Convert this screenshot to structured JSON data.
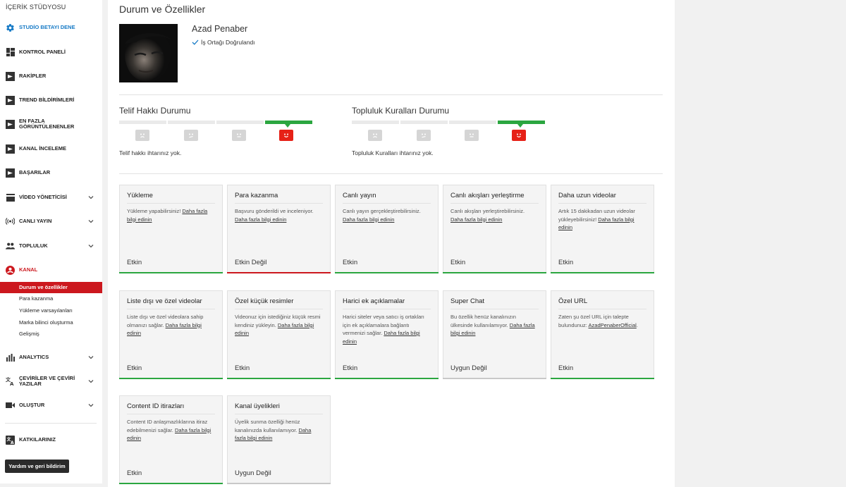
{
  "sidebar": {
    "header": "İÇERİK STÜDYOSU",
    "items": [
      {
        "label": "STUDİO BETAYI DENE",
        "icon": "gear-icon"
      },
      {
        "label": "KONTROL PANELİ",
        "icon": "dashboard-icon"
      },
      {
        "label": "RAKİPLER",
        "icon": "vidiq-icon"
      },
      {
        "label": "TREND BİLDİRİMLERİ",
        "icon": "vidiq-icon"
      },
      {
        "label_line1": "EN FAZLA",
        "label_line2": "GÖRÜNTÜLENENLER",
        "icon": "vidiq-icon"
      },
      {
        "label": "KANAL İNCELEME",
        "icon": "vidiq-icon"
      },
      {
        "label": "BAŞARILAR",
        "icon": "vidiq-icon"
      },
      {
        "label": "VİDEO YÖNETİCİSİ",
        "icon": "video-manager-icon"
      },
      {
        "label": "CANLI YAYIN",
        "icon": "live-icon"
      },
      {
        "label": "TOPLULUK",
        "icon": "community-icon"
      },
      {
        "label": "KANAL",
        "icon": "channel-icon"
      },
      {
        "label": "ANALYTICS",
        "icon": "analytics-icon"
      },
      {
        "label_line1": "ÇEVİRİLER VE ÇEVİRİ",
        "label_line2": "YAZILAR",
        "icon": "translate-icon"
      },
      {
        "label": "OLUŞTUR",
        "icon": "create-icon"
      },
      {
        "label": "KATKILARINIZ",
        "icon": "contributions-icon"
      }
    ],
    "sub_items": [
      "Durum ve özellikler",
      "Para kazanma",
      "Yükleme varsayılanları",
      "Marka bilinci oluşturma",
      "Gelişmiş"
    ],
    "feedback_button": "Yardım ve geri bildirim"
  },
  "main": {
    "title": "Durum ve Özellikler",
    "channel_name": "Azad Penaber",
    "verified_text": "İş Ortağı Doğrulandı",
    "copyright": {
      "title": "Telif Hakkı Durumu",
      "note": "Telif hakkı ihtarınız yok.",
      "level": 4,
      "levels": 4
    },
    "community": {
      "title": "Topluluk Kuralları Durumu",
      "note": "Topluluk Kuralları ihtarınız yok.",
      "level": 4,
      "levels": 4
    },
    "features": [
      {
        "title": "Yükleme",
        "desc": "Yükleme yapabilirsiniz! ",
        "link": "Daha fazla bilgi edinin",
        "status": "Etkin",
        "state": "on"
      },
      {
        "title": "Para kazanma",
        "desc": "Başvuru gönderildi ve inceleniyor. ",
        "link": "Daha fazla bilgi edinin",
        "status": "Etkin Değil",
        "state": "off"
      },
      {
        "title": "Canlı yayın",
        "desc": "Canlı yayın gerçekleştirebilirsiniz. ",
        "link": "Daha fazla bilgi edinin",
        "status": "Etkin",
        "state": "on"
      },
      {
        "title": "Canlı akışları yerleştirme",
        "desc": "Canlı akışları yerleştirebilirsiniz. ",
        "link": "Daha fazla bilgi edinin",
        "status": "Etkin",
        "state": "on"
      },
      {
        "title": "Daha uzun videolar",
        "desc": "Artık 15 dakikadan uzun videolar yükleyebilirsiniz! ",
        "link": "Daha fazla bilgi edinin",
        "status": "Etkin",
        "state": "on"
      },
      {
        "title": "Liste dışı ve özel videolar",
        "desc": "Liste dışı ve özel videolara sahip olmanızı sağlar. ",
        "link": "Daha fazla bilgi edinin",
        "status": "Etkin",
        "state": "on"
      },
      {
        "title": "Özel küçük resimler",
        "desc": "Videonuz için istediğiniz küçük resmi kendiniz yükleyin. ",
        "link": "Daha fazla bilgi edinin",
        "status": "Etkin",
        "state": "on"
      },
      {
        "title": "Harici ek açıklamalar",
        "desc": "Harici siteler veya satıcı iş ortakları için ek açıklamalara bağlantı vermenizi sağlar. ",
        "link": "Daha fazla bilgi edinin",
        "status": "Etkin",
        "state": "on"
      },
      {
        "title": "Super Chat",
        "desc": "Bu özellik henüz kanalınızın ülkesinde kullanılamıyor. ",
        "link": "Daha fazla bilgi edinin",
        "status": "Uygun Değil",
        "state": "na"
      },
      {
        "title": "Özel URL",
        "desc": "Zaten şu özel URL için talepte bulundunuz: ",
        "link": "AzadPenaberOfficial",
        "desc_tail": ".",
        "status": "Etkin",
        "state": "on"
      },
      {
        "title": "Content ID itirazları",
        "desc": "Content ID anlaşmazlıklarına itiraz edebilmenizi sağlar. ",
        "link": "Daha fazla bilgi edinin",
        "status": "Etkin",
        "state": "on"
      },
      {
        "title": "Kanal üyelikleri",
        "desc": "Üyelik sunma özelliği henüz kanalınızda kullanılamıyor. ",
        "link": "Daha fazla bilgi edinin",
        "status": "Uygun Değil",
        "state": "na"
      }
    ]
  },
  "colors": {
    "accent_red": "#cc181e",
    "active_green": "#2ba640",
    "studio_blue": "#167ac6"
  }
}
